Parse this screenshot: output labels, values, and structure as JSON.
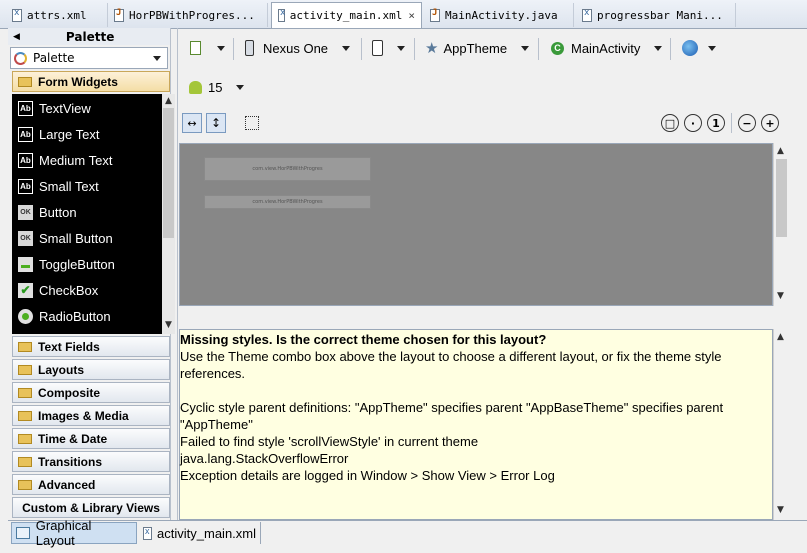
{
  "editor_tabs": [
    {
      "label": "attrs.xml",
      "icon": "xml-file-icon"
    },
    {
      "label": "HorPBWithProgres...",
      "icon": "java-file-icon"
    },
    {
      "label": "activity_main.xml",
      "icon": "layout-file-icon",
      "close": "×"
    },
    {
      "label": "MainActivity.java",
      "icon": "java-file-icon"
    },
    {
      "label": "progressbar Mani...",
      "icon": "xml-file-icon"
    }
  ],
  "palette": {
    "header": "Palette",
    "back_arrow": "◀",
    "select_value": "Palette",
    "categories": [
      "Form Widgets",
      "Text Fields",
      "Layouts",
      "Composite",
      "Images & Media",
      "Time & Date",
      "Transitions",
      "Advanced",
      "Custom & Library Views"
    ],
    "widgets": [
      {
        "label": "TextView",
        "icon": "textview-icon",
        "glyph": "Ab"
      },
      {
        "label": "Large Text",
        "icon": "large-text-icon",
        "glyph": "Ab"
      },
      {
        "label": "Medium Text",
        "icon": "medium-text-icon",
        "glyph": "Ab"
      },
      {
        "label": "Small Text",
        "icon": "small-text-icon",
        "glyph": "Ab"
      },
      {
        "label": "Button",
        "icon": "button-icon",
        "glyph": "OK"
      },
      {
        "label": "Small Button",
        "icon": "small-button-icon",
        "glyph": "OK"
      },
      {
        "label": "ToggleButton",
        "icon": "toggle-button-icon",
        "glyph": ""
      },
      {
        "label": "CheckBox",
        "icon": "checkbox-icon",
        "glyph": "✔"
      },
      {
        "label": "RadioButton",
        "icon": "radio-button-icon",
        "glyph": ""
      }
    ]
  },
  "toolbar": {
    "device": "Nexus One",
    "theme": "AppTheme",
    "activity": "MainActivity",
    "api_level": "15"
  },
  "canvas": {
    "preview_texts": [
      "com.view.HorPBWithProgres",
      "com.view.HorPBWithProgres"
    ]
  },
  "error_panel": {
    "title": "Missing styles. Is the correct theme chosen for this layout?",
    "lines": [
      "Use the Theme combo box above the layout to choose a different layout, or fix the theme style",
      "references.",
      "",
      "Cyclic style parent definitions: \"AppTheme\" specifies parent \"AppBaseTheme\" specifies parent",
      "\"AppTheme\"",
      "Failed to find style 'scrollViewStyle' in current theme",
      "java.lang.StackOverflowError",
      "Exception details are logged in Window > Show View > Error Log"
    ]
  },
  "bottom_tabs": [
    {
      "label": "Graphical Layout",
      "active": true
    },
    {
      "label": "activity_main.xml",
      "active": false
    }
  ],
  "colors": {
    "widget_list_bg": "#000000",
    "canvas_bg": "#878787",
    "error_bg": "#ffffe1",
    "android_green": "#a4c639"
  }
}
